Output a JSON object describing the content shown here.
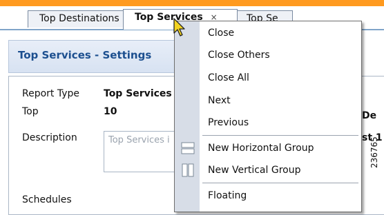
{
  "tabs": [
    {
      "label": "Top Destinations"
    },
    {
      "label": "Top Services",
      "close": "×"
    },
    {
      "label": "Top Se"
    }
  ],
  "settings": {
    "title": "Top Services - Settings",
    "report_type_label": "Report Type",
    "report_type_value": "Top Services",
    "top_label": "Top",
    "top_value": "10",
    "description_label": "Description",
    "description_value": "Top Services i",
    "schedules_label": "Schedules",
    "right_fragment_1": "De",
    "right_fragment_2": "st 1"
  },
  "context_menu": {
    "items": [
      {
        "label": "Close"
      },
      {
        "label": "Close Others"
      },
      {
        "label": "Close All"
      },
      {
        "label": "Next"
      },
      {
        "label": "Previous"
      },
      {
        "label": "New Horizontal Group"
      },
      {
        "label": "New Vertical Group"
      },
      {
        "label": "Floating"
      }
    ]
  },
  "figure_number": "236765"
}
